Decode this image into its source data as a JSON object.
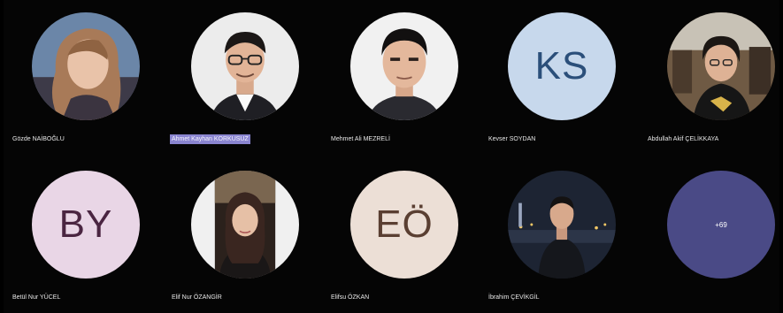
{
  "participants": [
    {
      "name": "Gözde NAİBOĞLU",
      "type": "photo",
      "icon": "person-photo-1"
    },
    {
      "name": "Ahmet Kayhan KORKUSUZ",
      "type": "photo",
      "icon": "person-photo-2",
      "active": true
    },
    {
      "name": "Mehmet Ali MEZRELİ",
      "type": "photo",
      "icon": "person-photo-3"
    },
    {
      "name": "Kevser SOYDAN",
      "type": "initials",
      "initials": "KS",
      "bg": "#c7d8ec",
      "fg": "#2b4f7a"
    },
    {
      "name": "Abdullah Akif ÇELİKKAYA",
      "type": "photo",
      "icon": "person-photo-5"
    },
    {
      "name": "Betül Nur YÜCEL",
      "type": "initials",
      "initials": "BY",
      "bg": "#e9d6e6",
      "fg": "#4a2541"
    },
    {
      "name": "Elif Nur ÖZANGİR",
      "type": "photo",
      "icon": "person-photo-7"
    },
    {
      "name": "Elifsu ÖZKAN",
      "type": "initials",
      "initials": "EÖ",
      "bg": "#ecdfd6",
      "fg": "#5a3f32"
    },
    {
      "name": "İbrahim ÇEVİKGİL",
      "type": "photo",
      "icon": "person-photo-9"
    }
  ],
  "overflow": {
    "label": "+69",
    "bg": "#4a4a86"
  }
}
